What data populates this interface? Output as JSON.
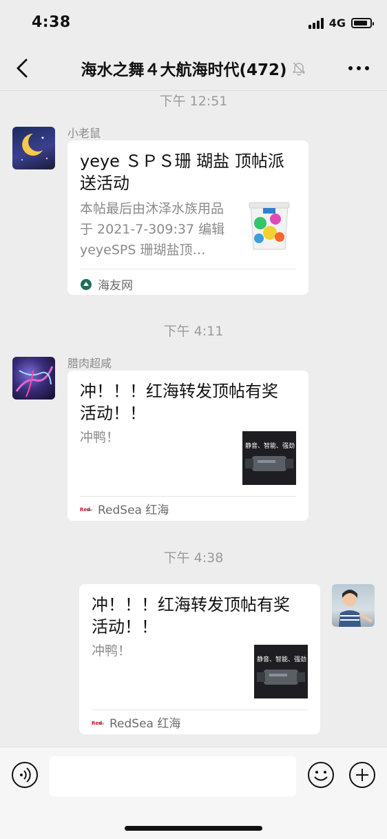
{
  "status_bar": {
    "time": "4:38",
    "network": "4G",
    "battery_level": 0.85
  },
  "nav": {
    "title": "海水之舞４大航海时代(472)",
    "back_icon": "chevron-left-icon",
    "mute_icon": "bell-off-icon",
    "more_icon": "more-dots-icon"
  },
  "messages": [
    {
      "timestamp": "下午 12:51",
      "sender": "小老鼠",
      "title": "yeye ＳＰＳ珊 瑚盐 顶帖派送活动",
      "description": "本帖最后由沐泽水族用品于 2021-7-309:37 编辑 yeyeSPS 珊瑚盐顶…",
      "source": "海友网",
      "thumb_icon": "salt-bucket-image"
    },
    {
      "timestamp": "下午 4:11",
      "sender": "腊肉超咸",
      "title": "冲！！！红海转发顶帖有奖活动！！",
      "description": "冲鸭！",
      "source": "RedSea 红海",
      "thumb_text": "静音、智能、强劲"
    },
    {
      "timestamp": "下午 4:38",
      "sender": "",
      "title": "冲！！！红海转发顶帖有奖活动！！",
      "description": "冲鸭！",
      "source": "RedSea 红海",
      "thumb_text": "静音、智能、强劲"
    }
  ],
  "input_bar": {
    "placeholder": "",
    "voice_icon": "voice-icon",
    "emoji_icon": "emoji-icon",
    "plus_icon": "plus-icon"
  },
  "colors": {
    "background": "#ededed",
    "card": "#ffffff",
    "muted_text": "#8a8a8a",
    "accent_green": "#07c160"
  }
}
